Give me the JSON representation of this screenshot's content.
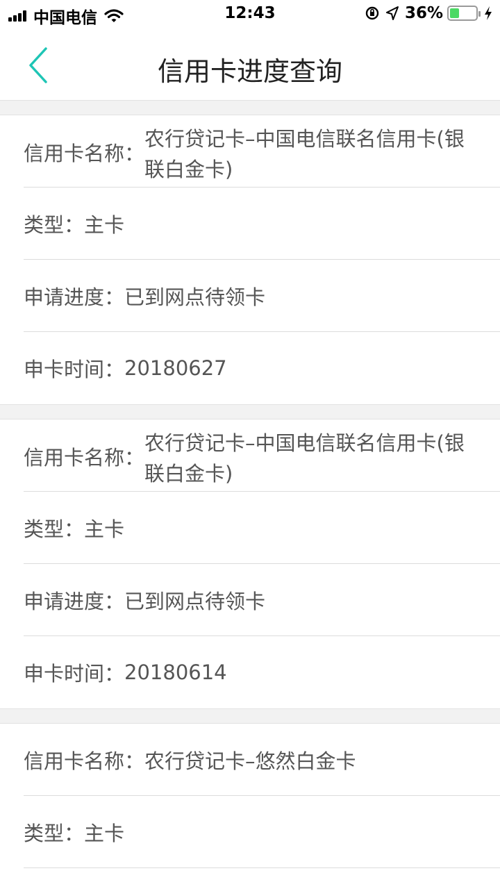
{
  "status_bar": {
    "carrier": "中国电信",
    "time": "12:43",
    "battery_percent": "36%",
    "battery_level": 0.36,
    "battery_color": "#4cd964"
  },
  "nav": {
    "title": "信用卡进度查询",
    "back_icon": "chevron-left-icon",
    "accent_color": "#1ec5b5"
  },
  "cards": [
    {
      "name_label": "信用卡名称：",
      "name_value": "农行贷记卡–中国电信联名信用卡(银联白金卡)",
      "type_label": "类型：",
      "type_value": "主卡",
      "progress_label": "申请进度：",
      "progress_value": "已到网点待领卡",
      "date_label": "申卡时间：",
      "date_value": "20180627"
    },
    {
      "name_label": "信用卡名称：",
      "name_value": "农行贷记卡–中国电信联名信用卡(银联白金卡)",
      "type_label": "类型：",
      "type_value": "主卡",
      "progress_label": "申请进度：",
      "progress_value": "已到网点待领卡",
      "date_label": "申卡时间：",
      "date_value": "20180614"
    },
    {
      "name_label": "信用卡名称：",
      "name_value": "农行贷记卡–悠然白金卡",
      "type_label": "类型：",
      "type_value": "主卡"
    }
  ]
}
